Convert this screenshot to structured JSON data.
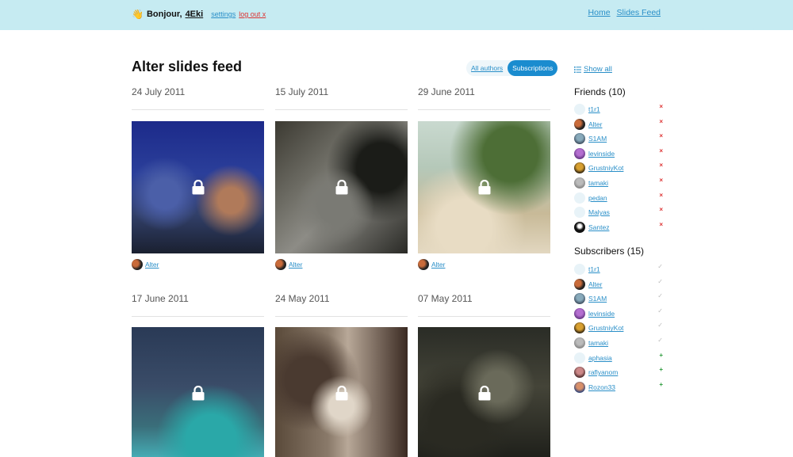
{
  "header": {
    "wave": "👋",
    "greeting": "Bonjour,",
    "username": "4Eki",
    "settings": "settings",
    "logout": "log out x",
    "nav": [
      "Home",
      "Slides Feed"
    ]
  },
  "page_title": "Alter slides feed",
  "filter": {
    "all": "All authors",
    "subscriptions": "Subscriptions",
    "active": "Subscriptions"
  },
  "slides": [
    {
      "date": "24 July 2011",
      "author": "Alter"
    },
    {
      "date": "15 July 2011",
      "author": "Alter"
    },
    {
      "date": "29 June 2011",
      "author": "Alter"
    },
    {
      "date": "17 June 2011",
      "author": ""
    },
    {
      "date": "24 May 2011",
      "author": ""
    },
    {
      "date": "07 May 2011",
      "author": ""
    }
  ],
  "sidebar": {
    "show_all": "Show all",
    "friends_title": "Friends (10)",
    "friends": [
      "t1r1",
      "Alter",
      "S1AM",
      "levinside",
      "GrustniyKot",
      "tamaki",
      "pedan",
      "Malyas",
      "Santez"
    ],
    "friend_mark": "×",
    "subscribers_title": "Subscribers (15)",
    "subscribers": [
      {
        "name": "t1r1",
        "mark": "✓"
      },
      {
        "name": "Alter",
        "mark": "✓"
      },
      {
        "name": "S1AM",
        "mark": "✓"
      },
      {
        "name": "levinside",
        "mark": "✓"
      },
      {
        "name": "GrustniyKot",
        "mark": "✓"
      },
      {
        "name": "tamaki",
        "mark": "✓"
      },
      {
        "name": "aphasia",
        "mark": "+"
      },
      {
        "name": "raflyanom",
        "mark": "+"
      },
      {
        "name": "Rozon33",
        "mark": "+"
      }
    ]
  },
  "colors": {
    "header_bg": "#c6ebf2",
    "link": "#2a8fc8",
    "accent": "#1a8ccf",
    "remove": "#dd3333",
    "add": "#2a9a3a"
  }
}
